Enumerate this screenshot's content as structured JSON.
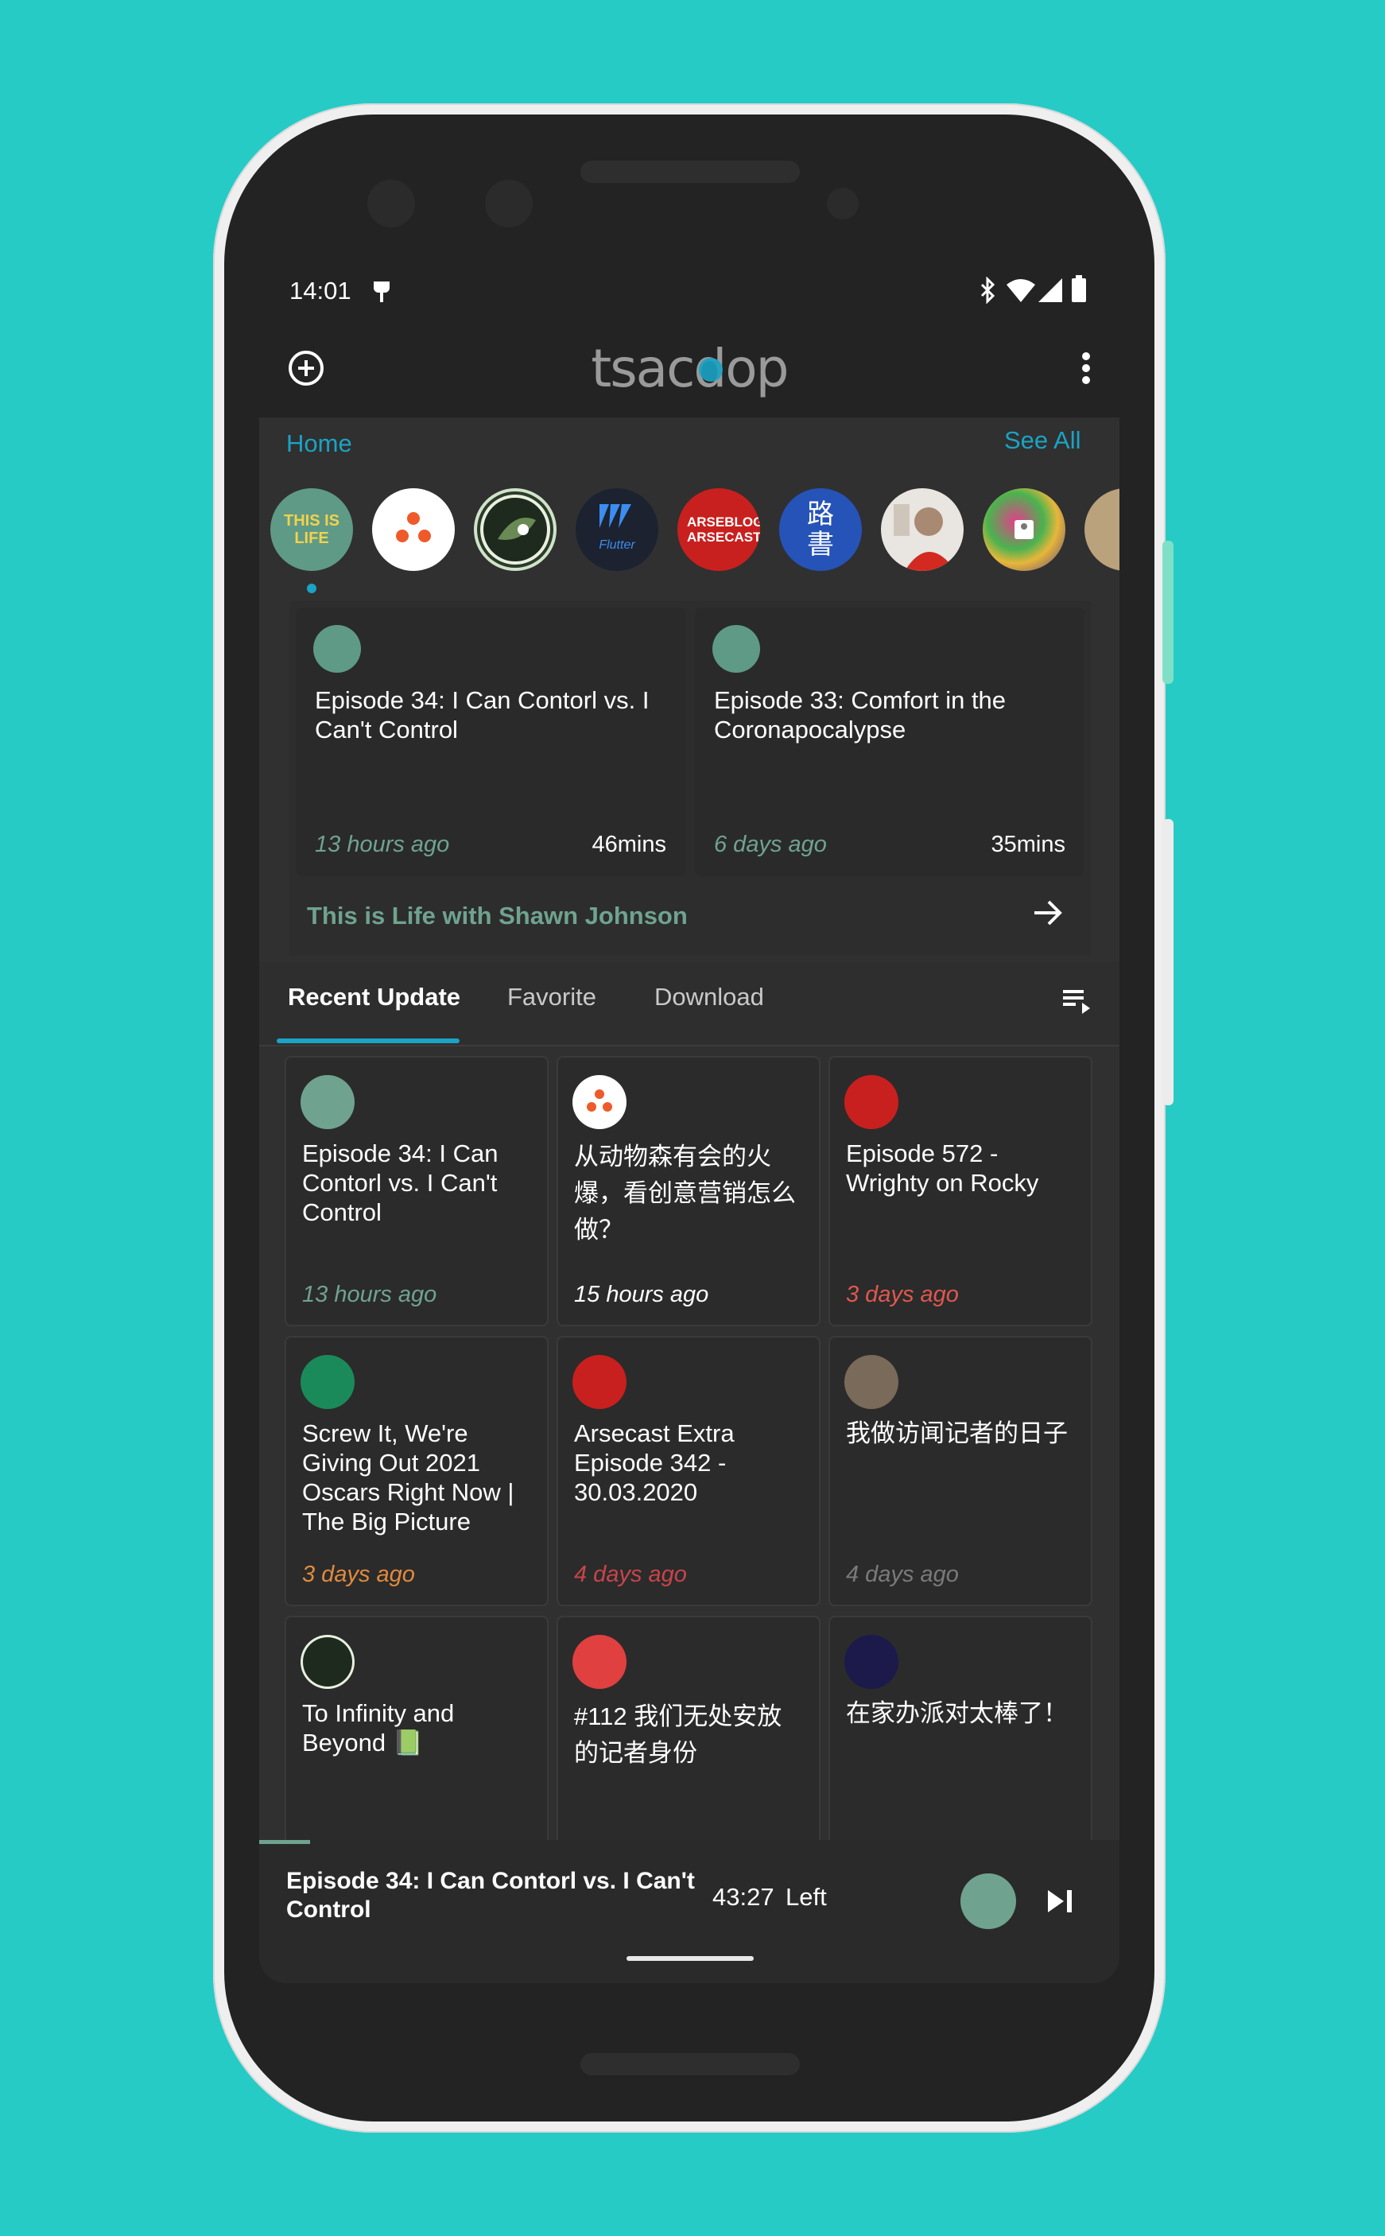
{
  "status": {
    "time": "14:01"
  },
  "app": {
    "logo": "tsacdop"
  },
  "home": {
    "label": "Home",
    "see_all": "See All"
  },
  "podcasts": [
    {
      "name": "This is Life",
      "art": "THIS IS LIFE",
      "color": "#5f9a86"
    },
    {
      "name": "Dots podcast",
      "art": "",
      "color": "#ffffff"
    },
    {
      "name": "Leaf podcast",
      "art": "",
      "color": "#2d3b2a"
    },
    {
      "name": "Flutter Podcast",
      "art": "Flutter Podcast",
      "color": "#1c2230"
    },
    {
      "name": "Arsecast",
      "art": "ARSEBLOG ARSECAST",
      "color": "#c8201e"
    },
    {
      "name": "On the Road",
      "art": "路書",
      "color": "#2553b8"
    },
    {
      "name": "Portrait podcast",
      "art": "",
      "color": "#e9e5e0"
    },
    {
      "name": "Colorful podcast",
      "art": "",
      "color": "#7a5c3a"
    },
    {
      "name": "Partial podcast",
      "art": "",
      "color": "#b9a27c"
    }
  ],
  "featured": {
    "episodes": [
      {
        "title": "Episode 34: I Can Contorl vs. I Can't Control",
        "ago": "13 hours ago",
        "duration": "46mins"
      },
      {
        "title": "Episode 33: Comfort in the Coronapocalypse",
        "ago": "6 days ago",
        "duration": "35mins"
      }
    ],
    "podcast_title": "This is Life with Shawn Johnson"
  },
  "tabs": {
    "recent": "Recent Update",
    "favorite": "Favorite",
    "download": "Download"
  },
  "grid": [
    {
      "title": "Episode 34: I Can Contorl vs. I Can't Control",
      "ago": "13 hours ago",
      "color": "#6fa38f"
    },
    {
      "title": "从动物森有会的火爆，看创意营销怎么做？",
      "ago": "15 hours ago",
      "color": "#ffffff"
    },
    {
      "title": "Episode 572 - Wrighty on Rocky",
      "ago": "3 days ago",
      "color": "#e0574f"
    },
    {
      "title": "Screw It, We're Giving Out 2021 Oscars Right Now | The Big Picture",
      "ago": "3 days ago",
      "color": "#e08a3e"
    },
    {
      "title": "Arsecast Extra Episode 342 - 30.03.2020",
      "ago": "4 days ago",
      "color": "#c8444a"
    },
    {
      "title": "我做访闻记者的日子",
      "ago": "4 days ago",
      "color": "#7a7a7a"
    },
    {
      "title": "To Infinity and Beyond 📗",
      "ago": "",
      "color": "#6fa38f"
    },
    {
      "title": "#112 我们无处安放的记者身份",
      "ago": "",
      "color": "#c8444a"
    },
    {
      "title": "在家办派对太棒了！",
      "ago": "",
      "color": "#7a5cc0"
    }
  ],
  "player": {
    "title": "Episode 34: I Can Contorl vs. I Can't Control",
    "time_left": "43:27",
    "left_label": "Left"
  }
}
